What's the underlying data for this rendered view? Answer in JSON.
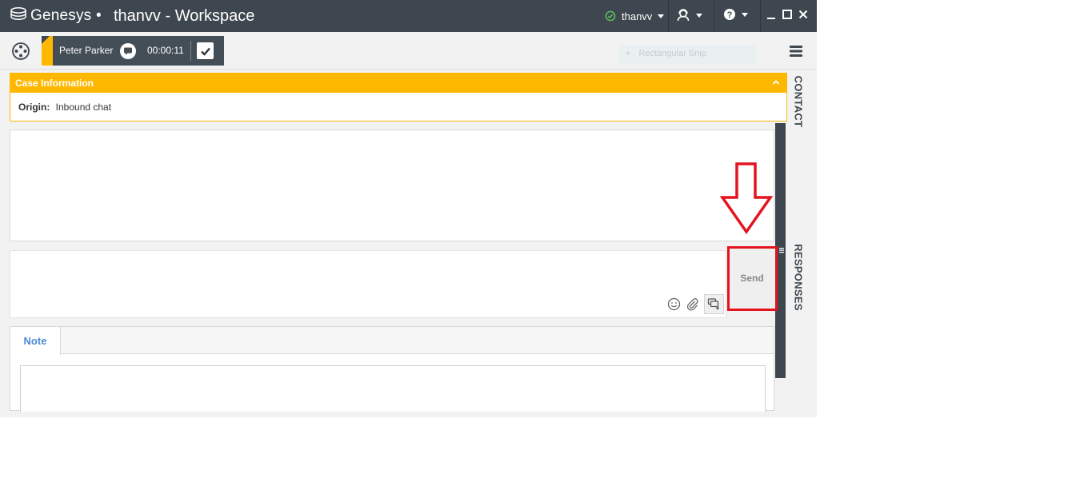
{
  "titlebar": {
    "brand": "Genesys",
    "separator": "•",
    "window_title": "thanvv - Workspace",
    "username": "thanvv",
    "status_color": "#5cb85c"
  },
  "toolbar": {
    "contact_name": "Peter Parker",
    "timer": "00:00:11",
    "ghost_label": "Rectangular Snip",
    "accent_color": "#ffb800"
  },
  "case_info": {
    "title": "Case Information",
    "origin_label": "Origin:",
    "origin_value": "Inbound chat"
  },
  "composer": {
    "send_label": "Send"
  },
  "note": {
    "tab_label": "Note"
  },
  "side_panels": {
    "contact_label": "CONTACT",
    "responses_label": "RESPONSES"
  },
  "icons": {
    "logo": "genesys-logo-icon",
    "status": "available-check-icon",
    "agent": "agent-icon",
    "help": "help-icon",
    "chat": "chat-bubble-icon",
    "done": "checkmark-icon",
    "emoji": "smiley-icon",
    "attach": "paperclip-icon",
    "responses": "standard-responses-icon",
    "menu": "hamburger-icon"
  },
  "annotation": {
    "highlight_color": "#e3141f"
  }
}
